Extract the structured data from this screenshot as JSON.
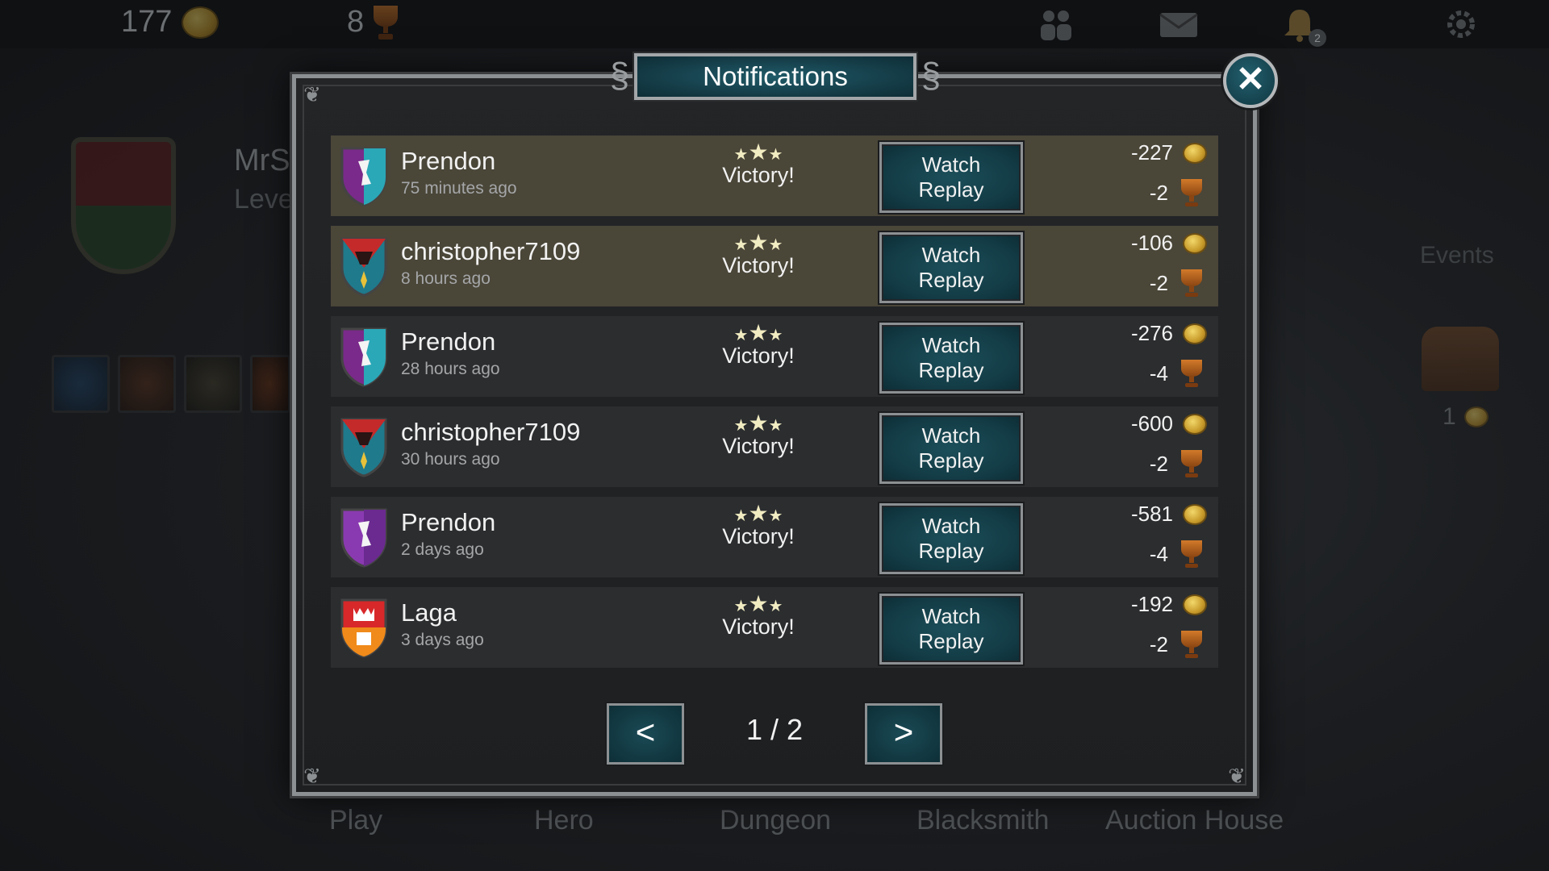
{
  "topbar": {
    "gold": "177",
    "trophies": "8",
    "notification_badge": "2",
    "icons": [
      "friends-icon",
      "mail-icon",
      "bell-icon",
      "gear-icon"
    ]
  },
  "background": {
    "player_name": "MrS",
    "player_level": "Leve",
    "events_label": "Events",
    "chest_count": "1"
  },
  "bottom_nav": [
    "Play",
    "Hero",
    "Dungeon",
    "Blacksmith",
    "Auction House"
  ],
  "dialog": {
    "title": "Notifications",
    "close_label": "✕",
    "watch_line1": "Watch",
    "watch_line2": "Replay",
    "notifications": [
      {
        "name": "Prendon",
        "time": "75 minutes ago",
        "result": "Victory!",
        "stars": 3,
        "gold": "-227",
        "trophies": "-2",
        "shield": "purple-teal",
        "highlight": true
      },
      {
        "name": "christopher7109",
        "time": "8 hours ago",
        "result": "Victory!",
        "stars": 3,
        "gold": "-106",
        "trophies": "-2",
        "shield": "teal-red",
        "highlight": true
      },
      {
        "name": "Prendon",
        "time": "28 hours ago",
        "result": "Victory!",
        "stars": 3,
        "gold": "-276",
        "trophies": "-4",
        "shield": "purple-teal",
        "highlight": false
      },
      {
        "name": "christopher7109",
        "time": "30 hours ago",
        "result": "Victory!",
        "stars": 3,
        "gold": "-600",
        "trophies": "-2",
        "shield": "teal-red",
        "highlight": false
      },
      {
        "name": "Prendon",
        "time": "2 days ago",
        "result": "Victory!",
        "stars": 3,
        "gold": "-581",
        "trophies": "-4",
        "shield": "purple",
        "highlight": false
      },
      {
        "name": "Laga",
        "time": "3 days ago",
        "result": "Victory!",
        "stars": 3,
        "gold": "-192",
        "trophies": "-2",
        "shield": "red-orange",
        "highlight": false
      }
    ],
    "pager": {
      "prev": "<",
      "next": ">",
      "indicator": "1 / 2"
    }
  },
  "colors": {
    "button_teal": "#123a44",
    "row_bg": "#2b2d2f",
    "row_highlight": "#4a4638",
    "frame": "#8d9092",
    "star": "#f2ecc2"
  }
}
